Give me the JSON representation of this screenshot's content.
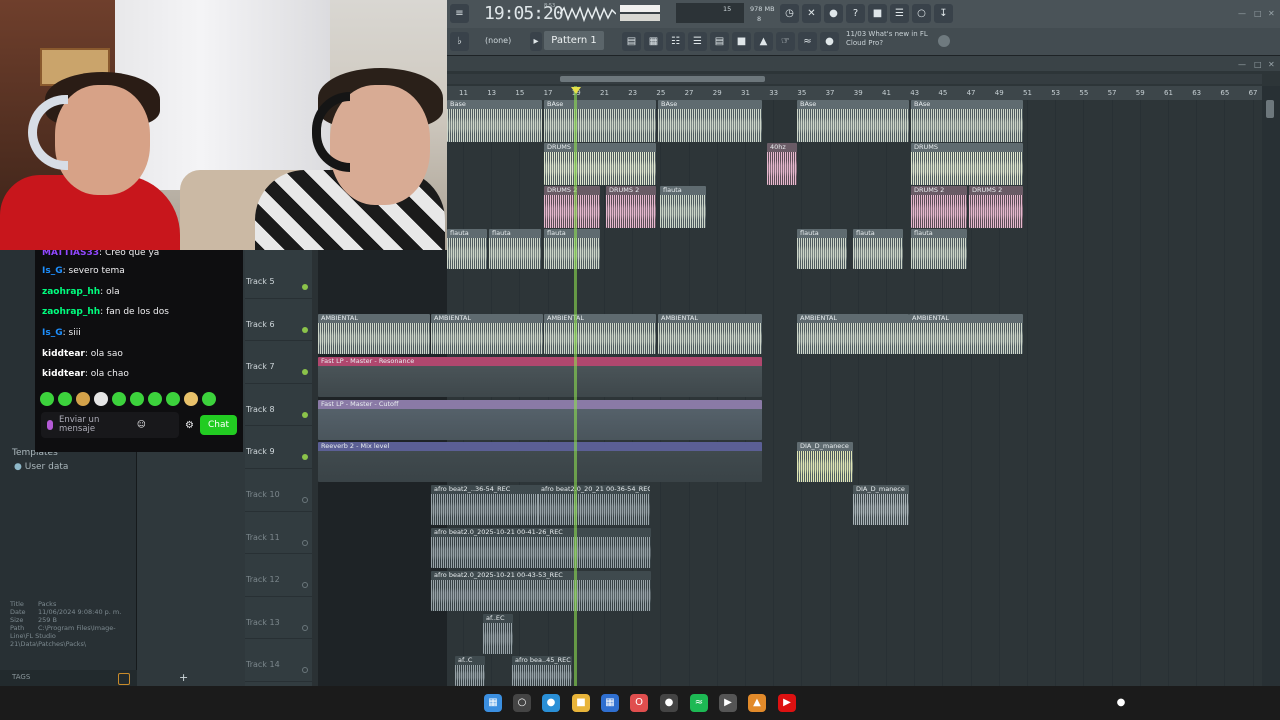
{
  "topbar": {
    "time": "19:05:20",
    "time_sub": "8:53",
    "cpu_mem": "978 MB",
    "cpu_a": "15",
    "cpu_b": "8",
    "snap": "(none)",
    "pattern": "Pattern 1",
    "news_line1": "11/03  What's new in FL",
    "news_line2": "Cloud Pro?",
    "icons": [
      "metronome-icon",
      "record-icon",
      "pattern-song-icon",
      "help-icon",
      "save-icon",
      "mixer-icon",
      "chat-icon",
      "download-icon"
    ]
  },
  "chat": {
    "messages": [
      {
        "user": "MATTIAS33",
        "user_color": "#9147ff",
        "text": "Creo que ya"
      },
      {
        "user": "Is_G",
        "user_color": "#1e90ff",
        "text": "severo tema"
      },
      {
        "user": "zaohrap_hh",
        "user_color": "#00ff7f",
        "text": "ola"
      },
      {
        "user": "zaohrap_hh",
        "user_color": "#00ff7f",
        "text": "fan de los dos"
      },
      {
        "user": "Is_G",
        "user_color": "#1e90ff",
        "text": "siii"
      },
      {
        "user": "kiddtear",
        "user_color": "#ffffff",
        "text": "ola sao"
      },
      {
        "user": "kiddtear",
        "user_color": "#ffffff",
        "text": "ola chao"
      }
    ],
    "input_placeholder": "Enviar un mensaje",
    "send_label": "Chat"
  },
  "browser": {
    "tree": [
      "Templates",
      "User data"
    ],
    "meta": [
      {
        "k": "Title",
        "v": "Packs"
      },
      {
        "k": "Date",
        "v": "11/06/2024 9:08:40 p. m."
      },
      {
        "k": "Size",
        "v": "259 B"
      },
      {
        "k": "Path",
        "v": "C:\\Program Files\\Image-Line\\FL Studio 21\\Data\\Patches\\Packs\\"
      }
    ],
    "tags_label": "TAGS"
  },
  "tracks": [
    {
      "label": "Track 5",
      "active": true
    },
    {
      "label": "Track 6",
      "active": true
    },
    {
      "label": "Track 7",
      "active": true
    },
    {
      "label": "Track 8",
      "active": true
    },
    {
      "label": "Track 9",
      "active": true
    },
    {
      "label": "Track 10",
      "active": false
    },
    {
      "label": "Track 11",
      "active": false
    },
    {
      "label": "Track 12",
      "active": false
    },
    {
      "label": "Track 13",
      "active": false
    },
    {
      "label": "Track 14",
      "active": false
    }
  ],
  "timeline": {
    "bars": [
      "11",
      "13",
      "15",
      "17",
      "19",
      "21",
      "23",
      "25",
      "27",
      "29",
      "31",
      "33",
      "35",
      "37",
      "39",
      "41",
      "43",
      "45",
      "47",
      "49",
      "51",
      "53",
      "55",
      "57",
      "59",
      "61",
      "63",
      "65",
      "67"
    ]
  },
  "clips": {
    "base": [
      "Base",
      "BAse",
      "BAse",
      "BAse",
      "BAse"
    ],
    "drums": [
      "DRUMS",
      "DRUMS",
      "40hz"
    ],
    "drums2": [
      "DRUMS 2",
      "DRUMS 2",
      "flauta",
      "DRUMS 2",
      "DRUMS 2"
    ],
    "flauta": [
      "flauta",
      "flauta",
      "flauta",
      "flauta",
      "flauta",
      "flauta"
    ],
    "ambiental": [
      "AMBIENTAL",
      "AMBIENTAL",
      "AMBIENTAL",
      "AMBIENTAL",
      "AMBIENTAL",
      "AMBIENTAL"
    ],
    "auto1": "Fast LP - Master - Resonance",
    "auto2": "Fast LP - Master - Cutoff",
    "auto3": "Reeverb 2 - Mix level",
    "dia": [
      "DIA_D_manece",
      "DIA_D_manece"
    ],
    "afro": [
      "afro beat2_..36-54_REC",
      "afro beat2.0_20_21 00-36-54_REC",
      "afro beat2.0_2025-10-21 00-41-26_REC",
      "afro beat2.0_2025-10-21 00-43-53_REC",
      "af..EC",
      "af..C",
      "afro bea..45_REC"
    ]
  }
}
